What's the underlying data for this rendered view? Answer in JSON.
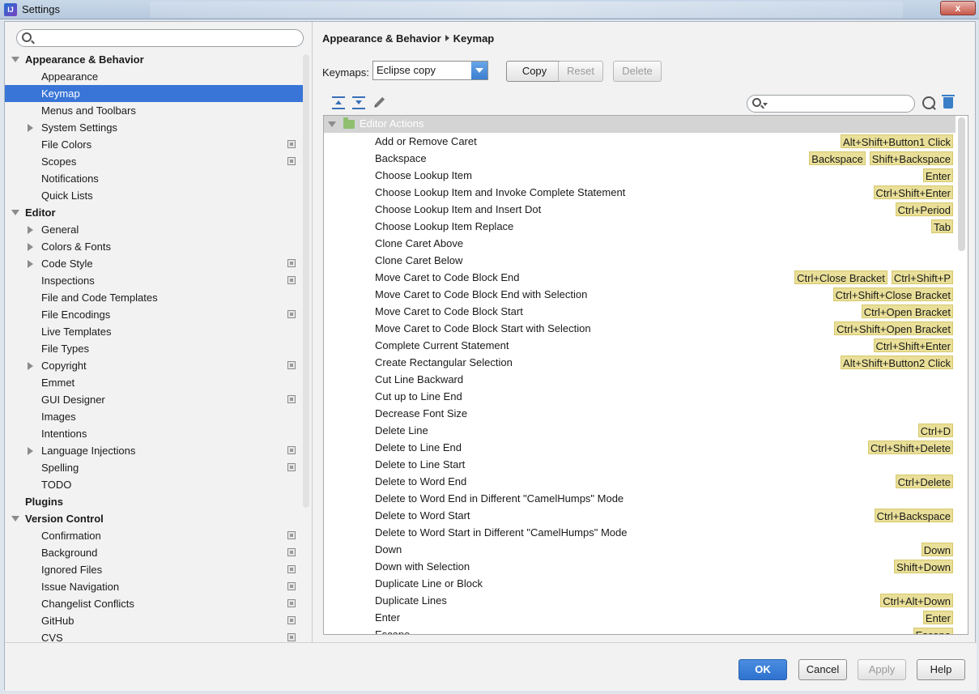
{
  "window": {
    "title": "Settings",
    "close_label": "x"
  },
  "sidebar": {
    "search_placeholder": "",
    "items": [
      {
        "label": "Appearance & Behavior",
        "level": 0,
        "expanded": true
      },
      {
        "label": "Appearance",
        "level": 1
      },
      {
        "label": "Keymap",
        "level": 1,
        "selected": true
      },
      {
        "label": "Menus and Toolbars",
        "level": 1
      },
      {
        "label": "System Settings",
        "level": 1,
        "collapsible": true
      },
      {
        "label": "File Colors",
        "level": 1,
        "project": true
      },
      {
        "label": "Scopes",
        "level": 1,
        "project": true
      },
      {
        "label": "Notifications",
        "level": 1
      },
      {
        "label": "Quick Lists",
        "level": 1
      },
      {
        "label": "Editor",
        "level": 0,
        "expanded": true
      },
      {
        "label": "General",
        "level": 1,
        "collapsible": true
      },
      {
        "label": "Colors & Fonts",
        "level": 1,
        "collapsible": true
      },
      {
        "label": "Code Style",
        "level": 1,
        "collapsible": true,
        "project": true
      },
      {
        "label": "Inspections",
        "level": 1,
        "project": true
      },
      {
        "label": "File and Code Templates",
        "level": 1
      },
      {
        "label": "File Encodings",
        "level": 1,
        "project": true
      },
      {
        "label": "Live Templates",
        "level": 1
      },
      {
        "label": "File Types",
        "level": 1
      },
      {
        "label": "Copyright",
        "level": 1,
        "collapsible": true,
        "project": true
      },
      {
        "label": "Emmet",
        "level": 1
      },
      {
        "label": "GUI Designer",
        "level": 1,
        "project": true
      },
      {
        "label": "Images",
        "level": 1
      },
      {
        "label": "Intentions",
        "level": 1
      },
      {
        "label": "Language Injections",
        "level": 1,
        "collapsible": true,
        "project": true
      },
      {
        "label": "Spelling",
        "level": 1,
        "project": true
      },
      {
        "label": "TODO",
        "level": 1
      },
      {
        "label": "Plugins",
        "level": 0
      },
      {
        "label": "Version Control",
        "level": 0,
        "expanded": true
      },
      {
        "label": "Confirmation",
        "level": 1,
        "project": true
      },
      {
        "label": "Background",
        "level": 1,
        "project": true
      },
      {
        "label": "Ignored Files",
        "level": 1,
        "project": true
      },
      {
        "label": "Issue Navigation",
        "level": 1,
        "project": true
      },
      {
        "label": "Changelist Conflicts",
        "level": 1,
        "project": true
      },
      {
        "label": "GitHub",
        "level": 1,
        "project": true
      },
      {
        "label": "CVS",
        "level": 1,
        "project": true
      }
    ]
  },
  "main": {
    "breadcrumb": {
      "parent": "Appearance & Behavior",
      "current": "Keymap"
    },
    "keymaps_label": "Keymaps:",
    "keymap_value": "Eclipse copy",
    "copy_label": "Copy",
    "reset_label": "Reset",
    "delete_label": "Delete",
    "filter_placeholder": "",
    "group": "Editor Actions",
    "actions": [
      {
        "name": "Add or Remove Caret",
        "shortcuts": [
          "Alt+Shift+Button1 Click"
        ]
      },
      {
        "name": "Backspace",
        "shortcuts": [
          "Backspace",
          "Shift+Backspace"
        ]
      },
      {
        "name": "Choose Lookup Item",
        "shortcuts": [
          "Enter"
        ]
      },
      {
        "name": "Choose Lookup Item and Invoke Complete Statement",
        "shortcuts": [
          "Ctrl+Shift+Enter"
        ]
      },
      {
        "name": "Choose Lookup Item and Insert Dot",
        "shortcuts": [
          "Ctrl+Period"
        ]
      },
      {
        "name": "Choose Lookup Item Replace",
        "shortcuts": [
          "Tab"
        ]
      },
      {
        "name": "Clone Caret Above",
        "shortcuts": []
      },
      {
        "name": "Clone Caret Below",
        "shortcuts": []
      },
      {
        "name": "Move Caret to Code Block End",
        "shortcuts": [
          "Ctrl+Close Bracket",
          "Ctrl+Shift+P"
        ]
      },
      {
        "name": "Move Caret to Code Block End with Selection",
        "shortcuts": [
          "Ctrl+Shift+Close Bracket"
        ]
      },
      {
        "name": "Move Caret to Code Block Start",
        "shortcuts": [
          "Ctrl+Open Bracket"
        ]
      },
      {
        "name": "Move Caret to Code Block Start with Selection",
        "shortcuts": [
          "Ctrl+Shift+Open Bracket"
        ]
      },
      {
        "name": "Complete Current Statement",
        "shortcuts": [
          "Ctrl+Shift+Enter"
        ]
      },
      {
        "name": "Create Rectangular Selection",
        "shortcuts": [
          "Alt+Shift+Button2 Click"
        ]
      },
      {
        "name": "Cut Line Backward",
        "shortcuts": []
      },
      {
        "name": "Cut up to Line End",
        "shortcuts": []
      },
      {
        "name": "Decrease Font Size",
        "shortcuts": []
      },
      {
        "name": "Delete Line",
        "shortcuts": [
          "Ctrl+D"
        ]
      },
      {
        "name": "Delete to Line End",
        "shortcuts": [
          "Ctrl+Shift+Delete"
        ]
      },
      {
        "name": "Delete to Line Start",
        "shortcuts": []
      },
      {
        "name": "Delete to Word End",
        "shortcuts": [
          "Ctrl+Delete"
        ]
      },
      {
        "name": "Delete to Word End in Different \"CamelHumps\" Mode",
        "shortcuts": []
      },
      {
        "name": "Delete to Word Start",
        "shortcuts": [
          "Ctrl+Backspace"
        ]
      },
      {
        "name": "Delete to Word Start in Different \"CamelHumps\" Mode",
        "shortcuts": []
      },
      {
        "name": "Down",
        "shortcuts": [
          "Down"
        ]
      },
      {
        "name": "Down with Selection",
        "shortcuts": [
          "Shift+Down"
        ]
      },
      {
        "name": "Duplicate Line or Block",
        "shortcuts": []
      },
      {
        "name": "Duplicate Lines",
        "shortcuts": [
          "Ctrl+Alt+Down"
        ]
      },
      {
        "name": "Enter",
        "shortcuts": [
          "Enter"
        ]
      },
      {
        "name": "Escape",
        "shortcuts": [
          "Escape"
        ]
      }
    ]
  },
  "footer": {
    "ok_label": "OK",
    "cancel_label": "Cancel",
    "apply_label": "Apply",
    "help_label": "Help"
  },
  "colors": {
    "selection": "#3875d7",
    "shortcut_chip": "#e9df98",
    "group_header": "#d4d4d4",
    "primary_button": "#2f72cf"
  }
}
